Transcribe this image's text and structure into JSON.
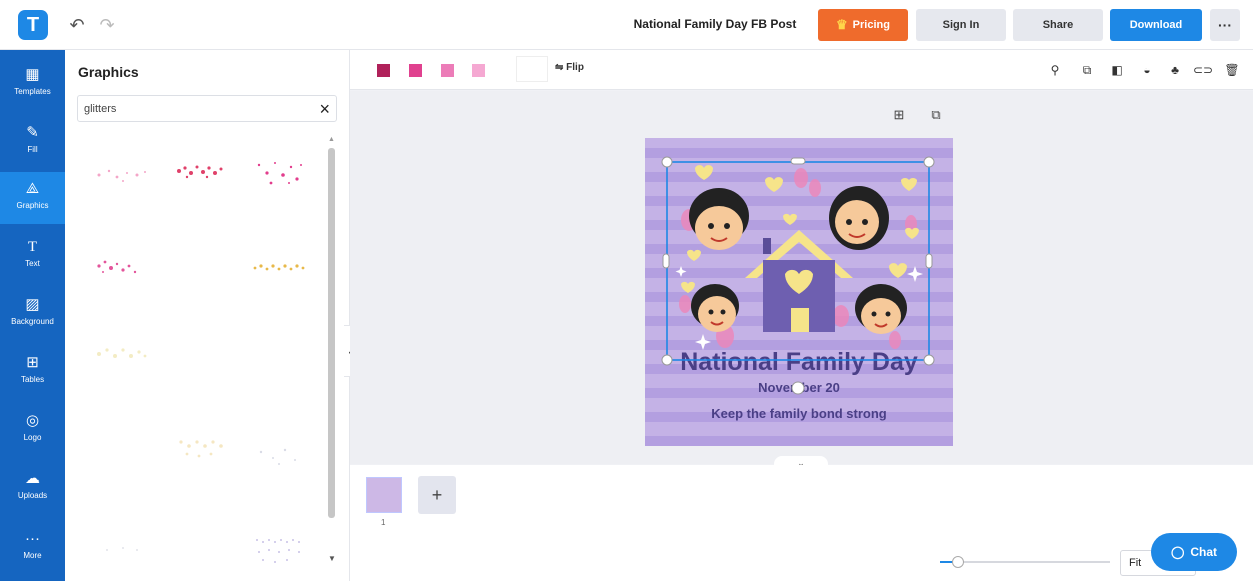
{
  "header": {
    "logo_letter": "T",
    "document_title": "National Family Day FB Post",
    "pricing_label": "Pricing",
    "signin_label": "Sign In",
    "share_label": "Share",
    "download_label": "Download",
    "more_label": "···"
  },
  "rail": {
    "items": [
      {
        "label": "Templates",
        "icon": "templates-icon"
      },
      {
        "label": "Fill",
        "icon": "fill-icon"
      },
      {
        "label": "Graphics",
        "icon": "graphics-icon",
        "active": true
      },
      {
        "label": "Text",
        "icon": "text-icon"
      },
      {
        "label": "Background",
        "icon": "background-icon"
      },
      {
        "label": "Tables",
        "icon": "tables-icon"
      },
      {
        "label": "Logo",
        "icon": "logo-icon"
      },
      {
        "label": "Uploads",
        "icon": "uploads-icon"
      },
      {
        "label": "More",
        "icon": "more-icon"
      }
    ]
  },
  "panel": {
    "title": "Graphics",
    "search_value": "glitters"
  },
  "toolbar": {
    "swatches": [
      "#b0215a",
      "#e0418f",
      "#ec7cb8",
      "#f5a8d2"
    ],
    "flip_label": "Flip"
  },
  "design": {
    "title": "National Family Day",
    "date": "November 20",
    "tagline": "Keep the family bond strong",
    "colors": {
      "background": "#c4b2e6",
      "stripe": "#b39fe0",
      "house": "#6e5fb0",
      "roof": "#f6e48a",
      "heart": "#f6e48a"
    }
  },
  "pages": {
    "current_page": "1"
  },
  "zoom": {
    "label": "Fit"
  },
  "chat": {
    "label": "Chat"
  }
}
